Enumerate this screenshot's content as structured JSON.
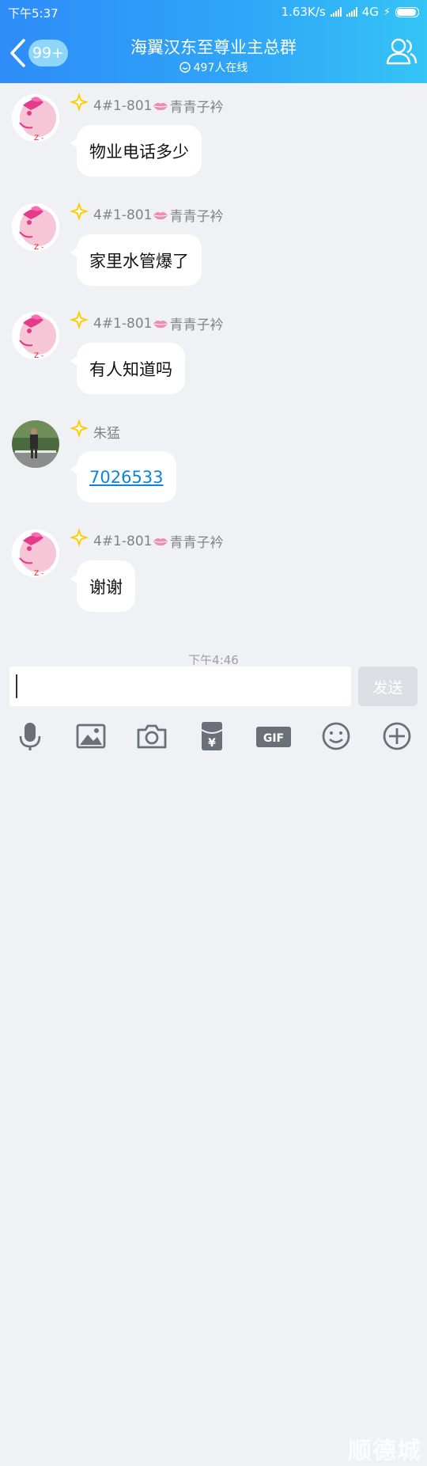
{
  "status_bar": {
    "time": "下午5:37",
    "network_speed": "1.63K/s",
    "network_type": "4G"
  },
  "header": {
    "unread_badge": "99+",
    "group_name": "海翼汉东至尊业主总群",
    "online_count": "497人在线"
  },
  "messages": [
    {
      "sender_prefix": "4#1-801",
      "sender_suffix": "青青子衿",
      "text": "物业电话多少",
      "avatar": "pink-cartoon-avatar"
    },
    {
      "sender_prefix": "4#1-801",
      "sender_suffix": "青青子衿",
      "text": "家里水管爆了",
      "avatar": "pink-cartoon-avatar"
    },
    {
      "sender_prefix": "4#1-801",
      "sender_suffix": "青青子衿",
      "text": "有人知道吗",
      "avatar": "pink-cartoon-avatar"
    },
    {
      "sender_prefix": "",
      "sender_suffix": "朱猛",
      "text": "7026533",
      "avatar": "photo-avatar",
      "is_link": true
    },
    {
      "sender_prefix": "4#1-801",
      "sender_suffix": "青青子衿",
      "text": "谢谢",
      "avatar": "pink-cartoon-avatar"
    }
  ],
  "timestamp_divider": "下午4:46",
  "composer": {
    "input_value": "",
    "send_label": "发送"
  },
  "toolbar": {
    "gif_label": "GIF",
    "watermark": "顺德城"
  },
  "colors": {
    "header_start": "#2e8cf8",
    "header_end": "#35c4f6",
    "chat_background": "#f0f1f5",
    "link": "#0d84d8",
    "send_disabled": "#dcdee3"
  }
}
